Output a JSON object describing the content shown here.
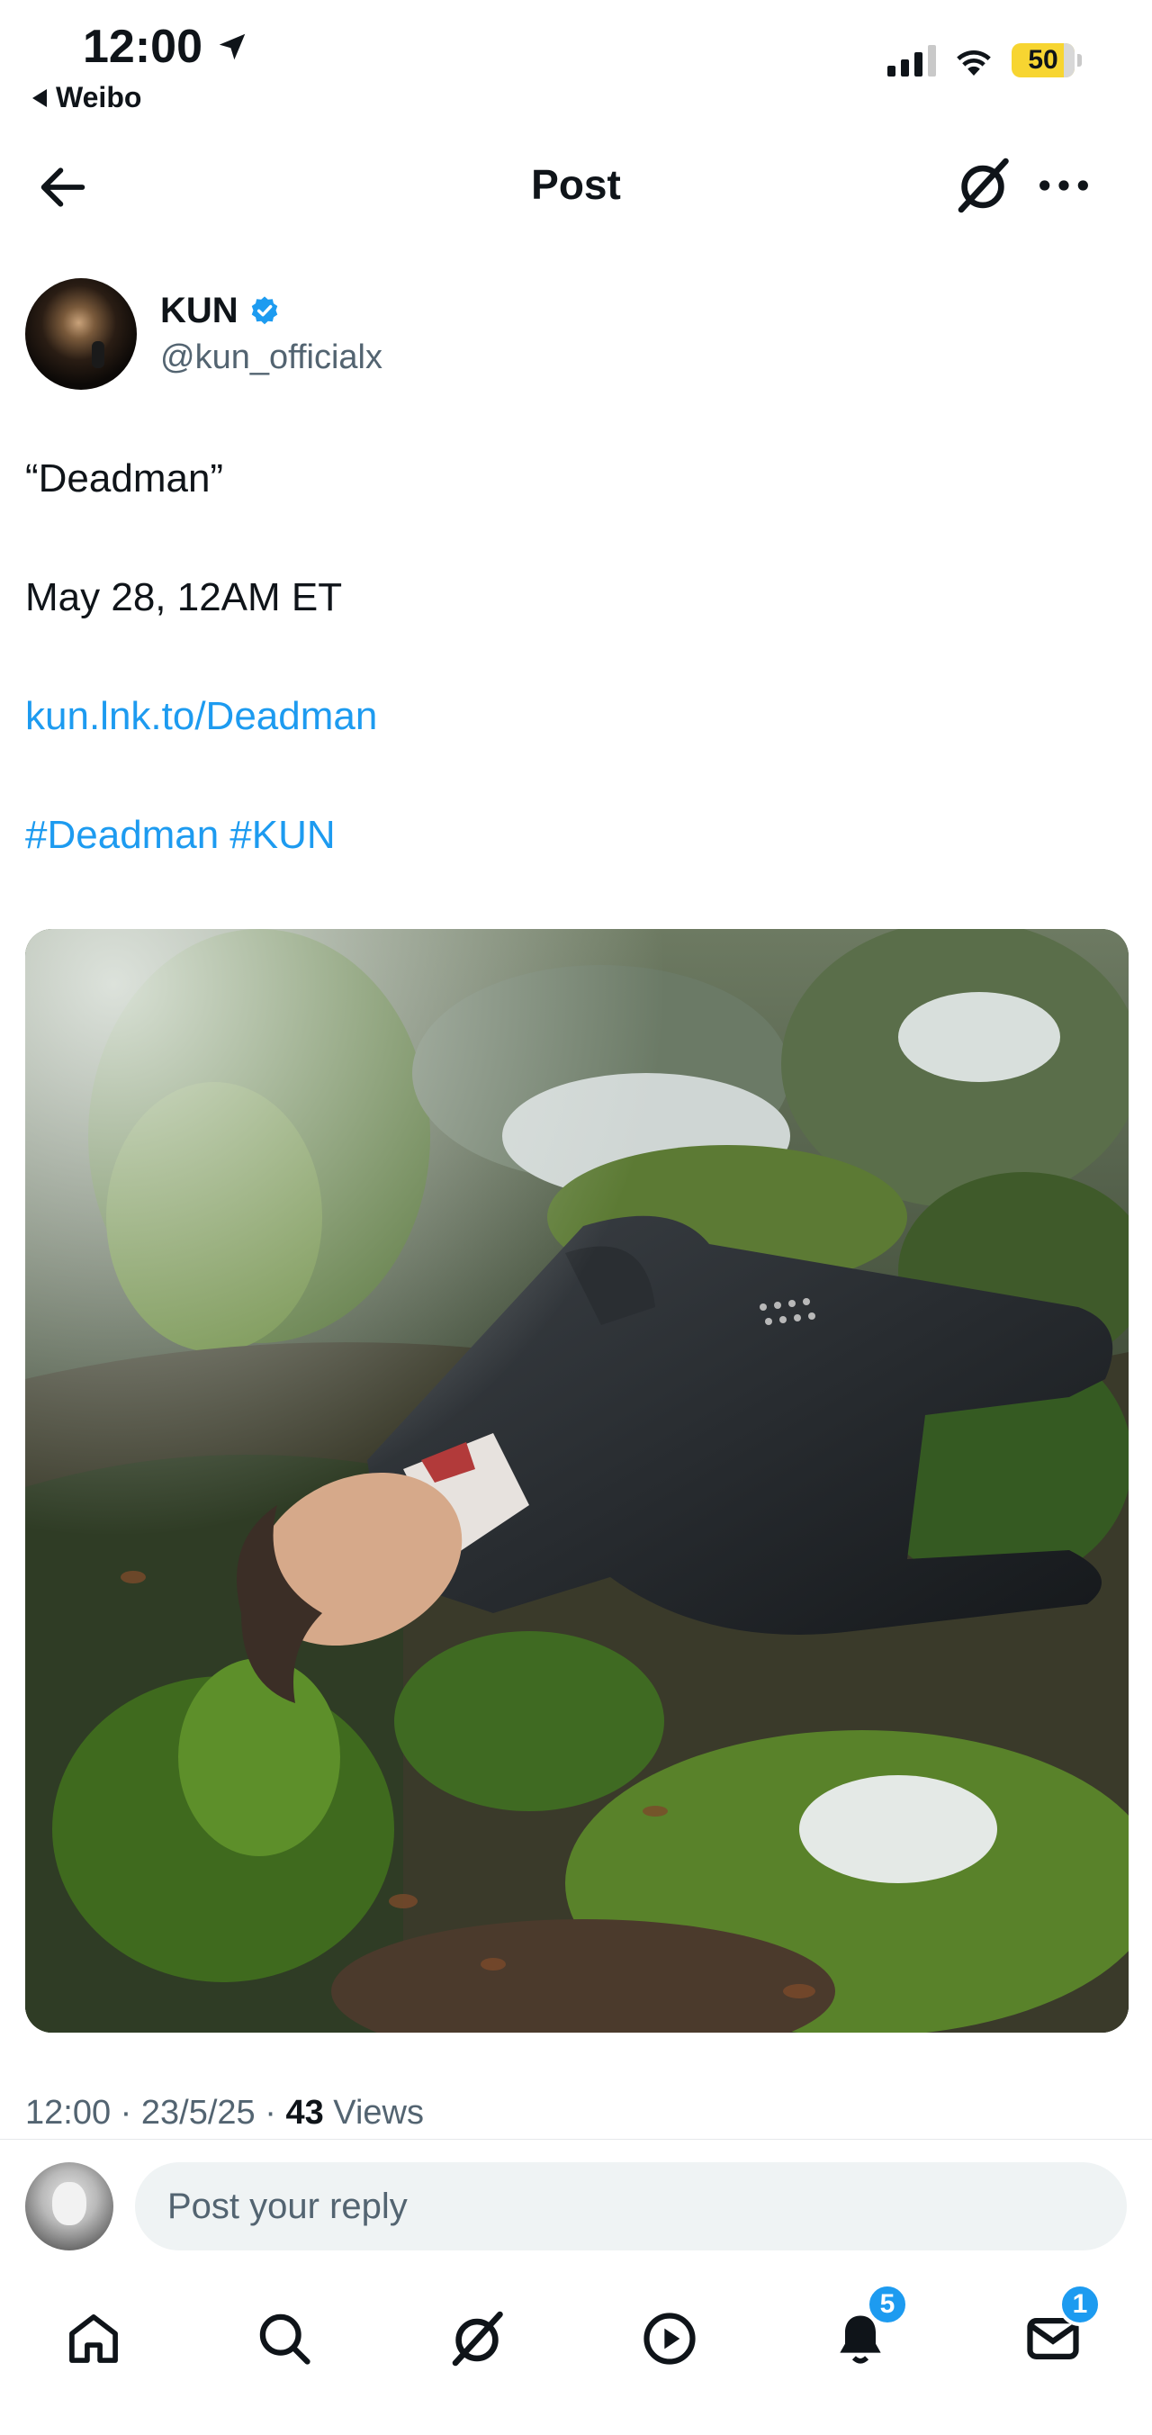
{
  "status_bar": {
    "time": "12:00",
    "back_app": "Weibo",
    "battery": "50"
  },
  "header": {
    "title": "Post"
  },
  "author": {
    "name": "KUN",
    "handle": "@kun_officialx"
  },
  "post": {
    "line1": "“Deadman”",
    "line2": "May 28, 12AM ET",
    "link": "kun.lnk.to/Deadman",
    "hashtags": [
      "#Deadman",
      "#KUN"
    ]
  },
  "meta": {
    "time": "12:00",
    "sep1": " · ",
    "date": "23/5/25",
    "sep2": " · ",
    "views_count": "43",
    "views_label": " Views"
  },
  "reply": {
    "placeholder": "Post your reply"
  },
  "tabbar": {
    "items": [
      {
        "icon": "home-icon"
      },
      {
        "icon": "search-icon"
      },
      {
        "icon": "grok-icon"
      },
      {
        "icon": "video-icon"
      },
      {
        "icon": "notifications-icon",
        "badge": "5"
      },
      {
        "icon": "messages-icon",
        "badge": "1"
      }
    ]
  },
  "colors": {
    "accent": "#1d9bf0",
    "text": "#0f1419",
    "secondary": "#536471",
    "battery": "#f7d531"
  }
}
